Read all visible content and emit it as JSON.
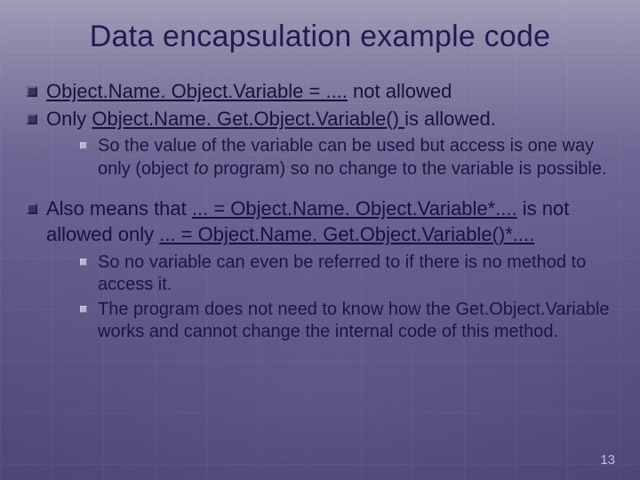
{
  "title": "Data encapsulation example code",
  "b1": {
    "u1": "Object.Name. Object.Variable = ....",
    "t1": " not allowed"
  },
  "b2": {
    "t1": "Only ",
    "u1": "Object.Name. Get.Object.Variable() ",
    "t2": "is allowed."
  },
  "s1": {
    "a": "So the value of the variable can be used but access is one way only (object ",
    "i": "to",
    "b": " program) so no change to the variable is possible."
  },
  "b3": {
    "t1": "Also means that ",
    "u1": "... = Object.Name. Object.Variable*....",
    "t2": " is not allowed only ",
    "u2": "... =  Object.Name. Get.Object.Variable()*...."
  },
  "s2a": "So no variable can even be referred to if there is no method to access it.",
  "s2b": "The program does not need to know how the Get.Object.Variable works and cannot change the internal code of this method.",
  "pageNumber": "13"
}
